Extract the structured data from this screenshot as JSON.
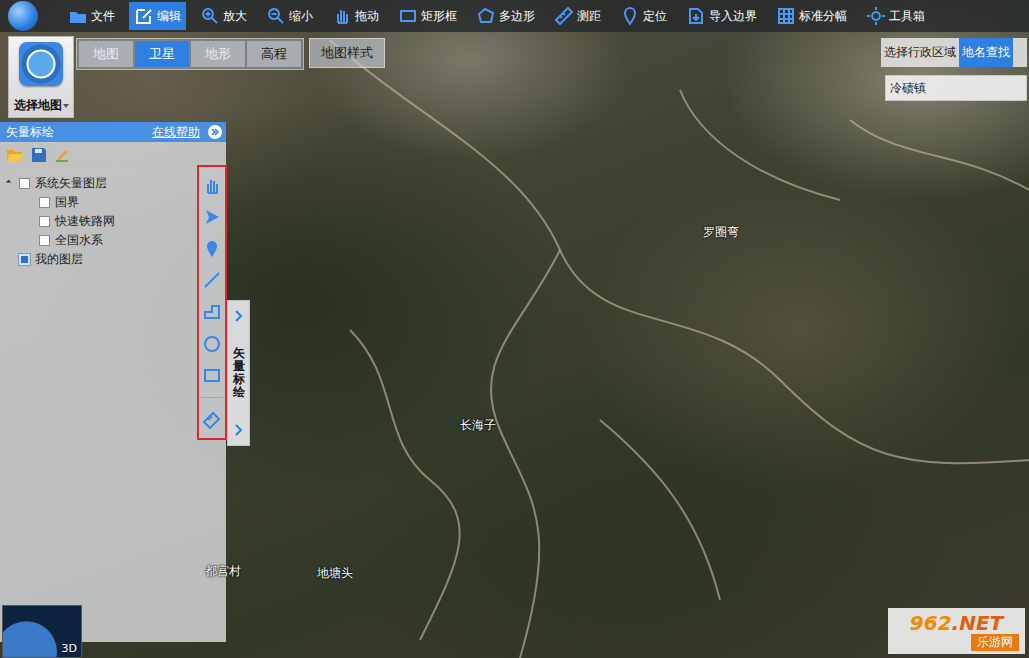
{
  "toolbar": [
    {
      "label": "文件",
      "selected": false
    },
    {
      "label": "编辑",
      "selected": true
    },
    {
      "label": "放大",
      "selected": false
    },
    {
      "label": "缩小",
      "selected": false
    },
    {
      "label": "拖动",
      "selected": false
    },
    {
      "label": "矩形框",
      "selected": false
    },
    {
      "label": "多边形",
      "selected": false
    },
    {
      "label": "测距",
      "selected": false
    },
    {
      "label": "定位",
      "selected": false
    },
    {
      "label": "导入边界",
      "selected": false
    },
    {
      "label": "标准分幅",
      "selected": false
    },
    {
      "label": "工具箱",
      "selected": false
    }
  ],
  "map_select": {
    "label": "选择地图"
  },
  "map_types": [
    {
      "label": "地图",
      "selected": false,
      "disabled": true
    },
    {
      "label": "卫星",
      "selected": true,
      "disabled": false
    },
    {
      "label": "地形",
      "selected": false,
      "disabled": true
    },
    {
      "label": "高程",
      "selected": false,
      "disabled": false
    }
  ],
  "map_style_button": "地图样式",
  "search_tabs": [
    {
      "label": "选择行政区域",
      "selected": false
    },
    {
      "label": "地名查找",
      "selected": true
    }
  ],
  "search": {
    "value": "冷碛镇"
  },
  "panel": {
    "title": "矢量标绘",
    "help": "在线帮助"
  },
  "layers": [
    {
      "label": "系统矢量图层",
      "checked": false,
      "expanded": true,
      "depth": 0,
      "has_children": true
    },
    {
      "label": "国界",
      "checked": false,
      "expanded": false,
      "depth": 1,
      "has_children": false
    },
    {
      "label": "快速铁路网",
      "checked": false,
      "expanded": false,
      "depth": 1,
      "has_children": false
    },
    {
      "label": "全国水系",
      "checked": false,
      "expanded": false,
      "depth": 1,
      "has_children": false
    },
    {
      "label": "我的图层",
      "checked": true,
      "expanded": false,
      "depth": 0,
      "has_children": false
    }
  ],
  "side_tab": {
    "label": "矢量标绘"
  },
  "map_labels": [
    {
      "text": "罗圈弯"
    },
    {
      "text": "长海子"
    },
    {
      "text": "都宫村"
    },
    {
      "text": "地塘头"
    }
  ],
  "minimap": {
    "label": "3D"
  },
  "watermark": {
    "number": "962",
    "suffix": ".NET",
    "site": "乐游网"
  }
}
